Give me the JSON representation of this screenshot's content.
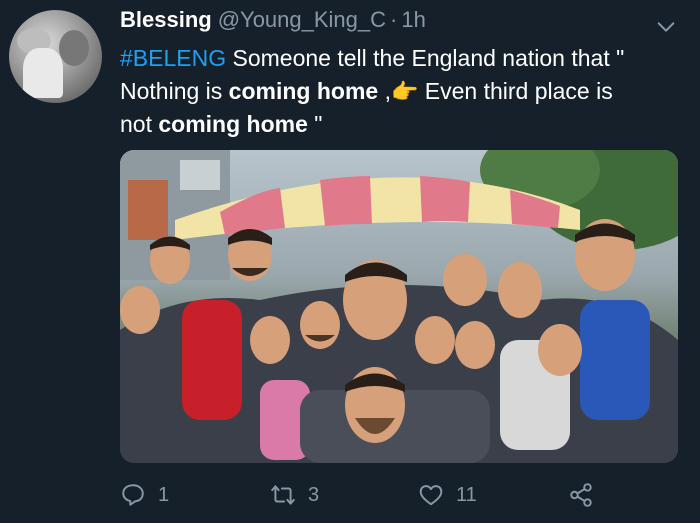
{
  "tweet": {
    "display_name": "Blessing",
    "handle": "@Young_King_C",
    "separator": "·",
    "time": "1h",
    "hashtag": "#BELENG",
    "text_1": " Someone tell the England nation that \"",
    "text_2": "Nothing is ",
    "bold_1": "coming home",
    "text_3": " ,",
    "emoji": "👉",
    "text_4": "  Even third place is",
    "text_5": "not ",
    "bold_2": "coming home",
    "text_6": "  \""
  },
  "actions": {
    "reply_count": "1",
    "retweet_count": "3",
    "like_count": "11"
  },
  "icons": {
    "reply": "reply-icon",
    "retweet": "retweet-icon",
    "like": "heart-icon",
    "share": "share-icon",
    "menu": "chevron-down-icon"
  },
  "colors": {
    "background": "#15202b",
    "secondary_text": "#8899a6",
    "hashtag": "#1da1f2"
  }
}
